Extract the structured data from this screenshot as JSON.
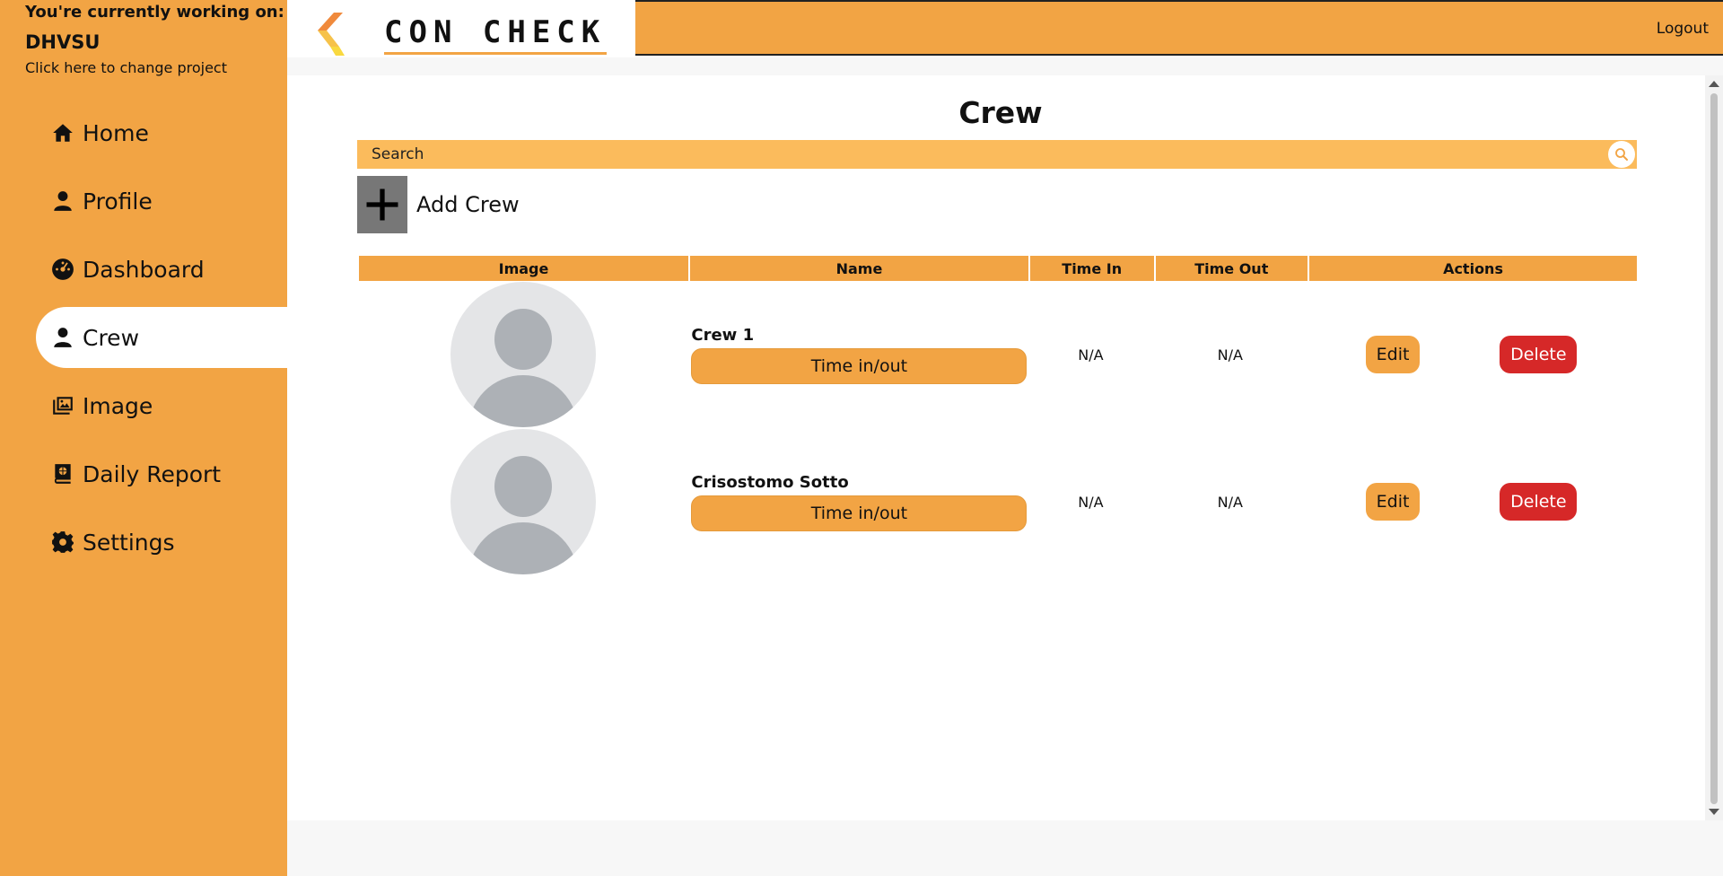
{
  "project": {
    "label": "You're currently working on:",
    "name": "DHVSU",
    "change_text": "Click here to change project"
  },
  "header": {
    "logo_text": "CON CHECK",
    "logout_label": "Logout",
    "accent_color": "#f2a444"
  },
  "sidebar": {
    "items": [
      {
        "label": "Home",
        "icon": "home-icon",
        "active": false
      },
      {
        "label": "Profile",
        "icon": "person-icon",
        "active": false
      },
      {
        "label": "Dashboard",
        "icon": "gauge-icon",
        "active": false
      },
      {
        "label": "Crew",
        "icon": "person-icon",
        "active": true
      },
      {
        "label": "Image",
        "icon": "images-icon",
        "active": false
      },
      {
        "label": "Daily Report",
        "icon": "book-icon",
        "active": false
      },
      {
        "label": "Settings",
        "icon": "gear-icon",
        "active": false
      }
    ]
  },
  "main": {
    "title": "Crew",
    "search_placeholder": "Search",
    "add_label": "Add Crew",
    "table": {
      "headers": [
        "Image",
        "Name",
        "Time In",
        "Time Out",
        "Actions"
      ],
      "rows": [
        {
          "name": "Crew 1",
          "time_button": "Time in/out",
          "time_in": "N/A",
          "time_out": "N/A",
          "edit": "Edit",
          "delete": "Delete"
        },
        {
          "name": "Crisostomo Sotto",
          "time_button": "Time in/out",
          "time_in": "N/A",
          "time_out": "N/A",
          "edit": "Edit",
          "delete": "Delete"
        }
      ]
    }
  }
}
